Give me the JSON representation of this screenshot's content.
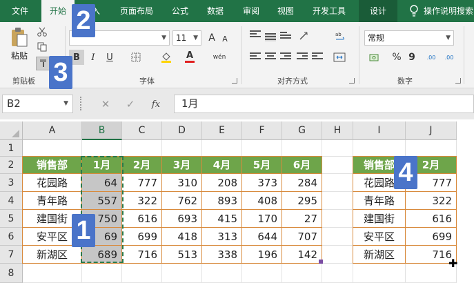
{
  "tabs": [
    "文件",
    "开始",
    "插入",
    "页面布局",
    "公式",
    "数据",
    "审阅",
    "视图",
    "开发工具",
    "设计"
  ],
  "help_text": "操作说明搜索",
  "ribbon": {
    "clipboard": {
      "label": "剪贴板",
      "paste": "粘贴"
    },
    "font": {
      "label": "字体",
      "size": "11",
      "bold": "B",
      "italic": "I",
      "underline": "U",
      "grow": "A",
      "shrink": "A",
      "font_color": "A",
      "phonetic": "wén"
    },
    "alignment": {
      "label": "对齐方式"
    },
    "number": {
      "label": "数字",
      "format": "常规",
      "percent": "%",
      "comma": "9",
      "inc_decimal": ".00",
      "dec_decimal": ".00"
    }
  },
  "formula_bar": {
    "name_box": "B2",
    "content": "1月",
    "fx": "fx"
  },
  "columns": [
    "A",
    "B",
    "C",
    "D",
    "E",
    "F",
    "G",
    "H",
    "I",
    "J"
  ],
  "rows": [
    "1",
    "2",
    "3",
    "4",
    "5",
    "6",
    "7",
    "8"
  ],
  "table1": {
    "headers": [
      "销售部",
      "1月",
      "2月",
      "3月",
      "4月",
      "5月",
      "6月"
    ],
    "rows": [
      [
        "花园路",
        "64",
        "777",
        "310",
        "208",
        "373",
        "284"
      ],
      [
        "青年路",
        "557",
        "322",
        "762",
        "893",
        "408",
        "295"
      ],
      [
        "建国街",
        "750",
        "616",
        "693",
        "415",
        "170",
        "27"
      ],
      [
        "安平区",
        "69",
        "699",
        "418",
        "313",
        "644",
        "707"
      ],
      [
        "新湖区",
        "689",
        "716",
        "513",
        "338",
        "196",
        "142"
      ]
    ]
  },
  "table2": {
    "headers": [
      "销售部",
      "2月"
    ],
    "rows": [
      [
        "花园路",
        "777"
      ],
      [
        "青年路",
        "322"
      ],
      [
        "建国街",
        "616"
      ],
      [
        "安平区",
        "699"
      ],
      [
        "新湖区",
        "716"
      ]
    ]
  },
  "badges": [
    "1",
    "2",
    "3",
    "4"
  ],
  "colors": {
    "ribbon": "#217346",
    "table_header": "#6ea54a",
    "table_border": "#d88a3c",
    "badge": "#4a74c9"
  }
}
